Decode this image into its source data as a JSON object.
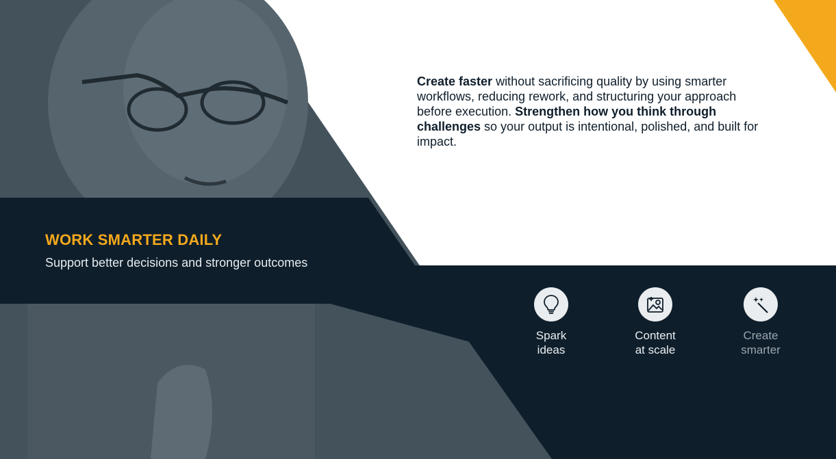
{
  "colors": {
    "accent": "#f4a91c",
    "navy": "#0f1e2b",
    "slate_overlay": "#3d4a54",
    "white": "#ffffff"
  },
  "intro": {
    "lead_bold": "Create faster",
    "lead_text": " without sacrificing quality by using smarter workflows, reducing rework, and structuring your approach before execution. ",
    "second_bold": "Strengthen how you think through challenges",
    "second_text": " so your output is intentional, polished, and built for impact."
  },
  "banner": {
    "headline": "WORK SMARTER DAILY",
    "subline": "Support better decisions and stronger outcomes"
  },
  "features": [
    {
      "icon": "lightbulb-icon",
      "line1": "Spark",
      "line2": "ideas"
    },
    {
      "icon": "image-add-icon",
      "line1": "Content",
      "line2": "at scale"
    },
    {
      "icon": "magic-wand-icon",
      "line1": "Create",
      "line2": "smarter"
    }
  ]
}
